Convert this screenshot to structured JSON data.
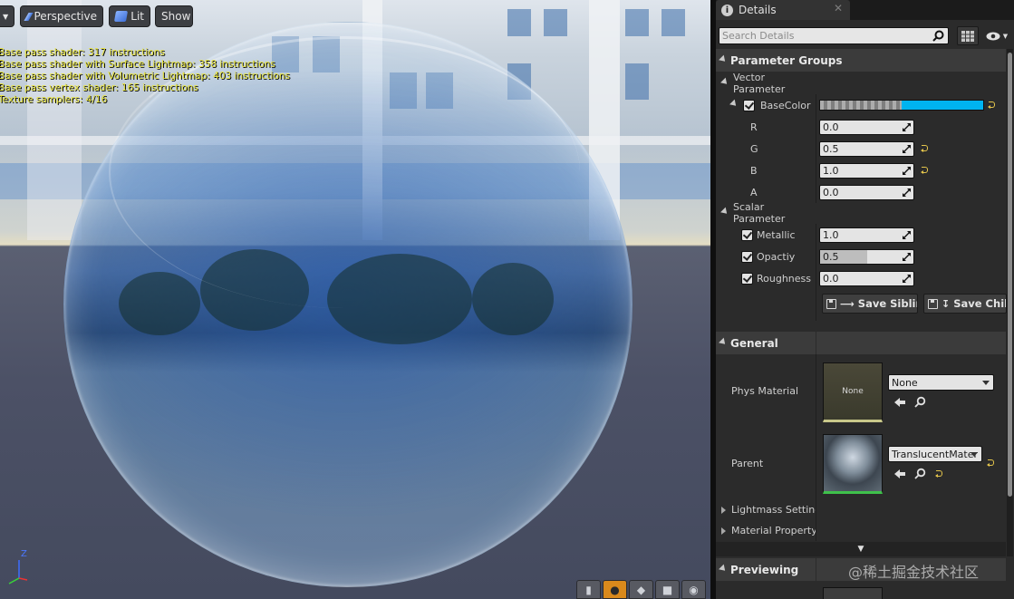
{
  "viewport": {
    "toolbar": {
      "perspective_label": "Perspective",
      "lit_label": "Lit",
      "show_label": "Show"
    },
    "shader_stats": [
      "Base pass shader: 317 instructions",
      "Base pass shader with Surface Lightmap: 358 instructions",
      "Base pass shader with Volumetric Lightmap: 403 instructions",
      "Base pass vertex shader: 165 instructions",
      "Texture samplers: 4/16"
    ],
    "axis": {
      "z_label": "Z"
    }
  },
  "details": {
    "tab_title": "Details",
    "search": {
      "placeholder": "Search Details",
      "value": ""
    },
    "parameter_groups": {
      "title": "Parameter Groups",
      "vector_parameter": {
        "title": "Vector Parameter",
        "base_color": {
          "label": "BaseColor",
          "swatch_color": "#00b3f0",
          "channels": [
            {
              "label": "R",
              "value": "0.0",
              "modified": false
            },
            {
              "label": "G",
              "value": "0.5",
              "modified": true
            },
            {
              "label": "B",
              "value": "1.0",
              "modified": true
            },
            {
              "label": "A",
              "value": "0.0",
              "modified": false
            }
          ]
        }
      },
      "scalar_parameter": {
        "title": "Scalar Parameter",
        "items": [
          {
            "label": "Metallic",
            "value": "1.0"
          },
          {
            "label": "Opactiy",
            "value": "0.5"
          },
          {
            "label": "Roughness",
            "value": "0.0"
          }
        ]
      },
      "save_sibling_label": "Save Sibling",
      "save_child_label": "Save Child"
    },
    "general": {
      "title": "General",
      "phys_material": {
        "label": "Phys Material",
        "thumb_text": "None",
        "value": "None"
      },
      "parent": {
        "label": "Parent",
        "value": "TranslucentMater"
      },
      "lightmass_label": "Lightmass Setting",
      "material_property_label": "Material Property"
    },
    "previewing": {
      "title": "Previewing"
    }
  },
  "watermark": "@稀土掘金技术社区",
  "colors": {
    "accent_orange": "#d9891c",
    "reset_yellow": "#e3c44b",
    "base_color_blue": "#00b3f0"
  }
}
